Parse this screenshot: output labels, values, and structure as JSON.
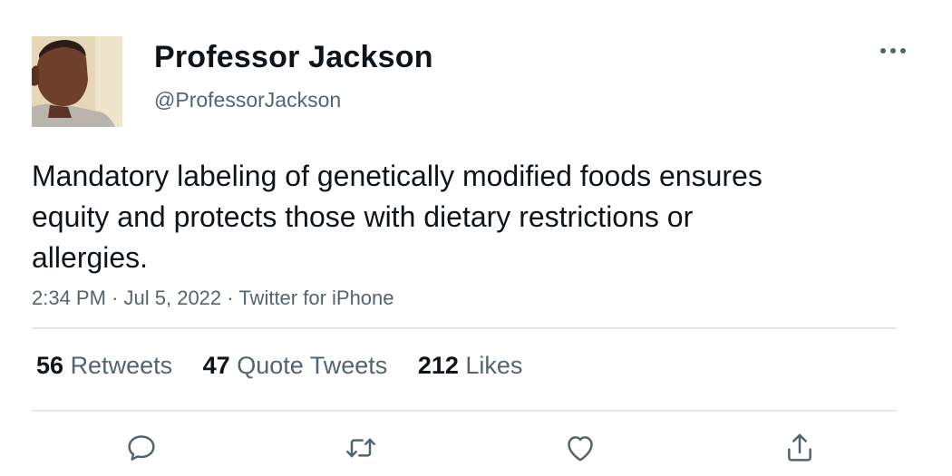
{
  "author": {
    "display_name": "Professor Jackson",
    "handle": "@ProfessorJackson"
  },
  "tweet": {
    "text": "Mandatory labeling of genetically modified foods ensures equity and protects those with dietary restrictions or allergies.",
    "time": "2:34 PM",
    "date": "Jul 5, 2022",
    "source": "Twitter for iPhone",
    "separator": "·"
  },
  "stats": {
    "retweets_count": "56",
    "retweets_label": "Retweets",
    "quotes_count": "47",
    "quotes_label": "Quote Tweets",
    "likes_count": "212",
    "likes_label": "Likes"
  },
  "icons": {
    "more": "more-horizontal-icon",
    "reply": "reply-icon",
    "retweet": "retweet-icon",
    "like": "heart-icon",
    "share": "share-icon"
  },
  "colors": {
    "text": "#0f1419",
    "secondary": "#536471",
    "divider": "#e4e7ea"
  }
}
